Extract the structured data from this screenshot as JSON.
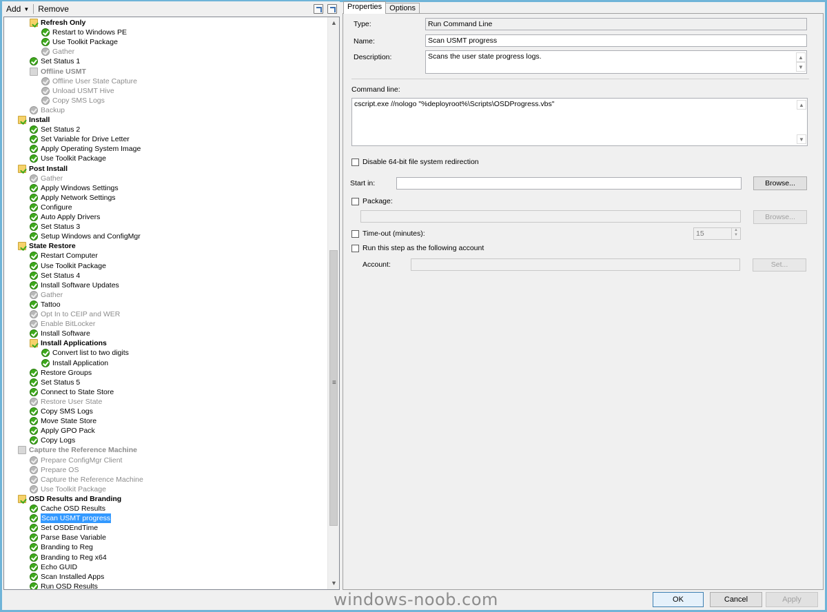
{
  "toolbar": {
    "add_label": "Add",
    "remove_label": "Remove",
    "icons": [
      "move-up-icon",
      "move-down-icon"
    ]
  },
  "tree": {
    "nodes": [
      {
        "label": "Refresh Only",
        "type": "group",
        "state": "enabled",
        "indent": 2
      },
      {
        "label": "Restart to Windows PE",
        "type": "step",
        "state": "enabled",
        "indent": 3
      },
      {
        "label": "Use Toolkit Package",
        "type": "step",
        "state": "enabled",
        "indent": 3
      },
      {
        "label": "Gather",
        "type": "step",
        "state": "disabled",
        "indent": 3
      },
      {
        "label": "Set Status 1",
        "type": "step",
        "state": "enabled",
        "indent": 2
      },
      {
        "label": "Offline USMT",
        "type": "group",
        "state": "disabled",
        "indent": 2
      },
      {
        "label": "Offline User State Capture",
        "type": "step",
        "state": "disabled",
        "indent": 3
      },
      {
        "label": "Unload USMT Hive",
        "type": "step",
        "state": "disabled",
        "indent": 3
      },
      {
        "label": "Copy SMS Logs",
        "type": "step",
        "state": "disabled",
        "indent": 3
      },
      {
        "label": "Backup",
        "type": "step",
        "state": "disabled",
        "indent": 2
      },
      {
        "label": "Install",
        "type": "group",
        "state": "enabled",
        "indent": 1
      },
      {
        "label": "Set Status 2",
        "type": "step",
        "state": "enabled",
        "indent": 2
      },
      {
        "label": "Set Variable for Drive Letter",
        "type": "step",
        "state": "enabled",
        "indent": 2
      },
      {
        "label": "Apply Operating System Image",
        "type": "step",
        "state": "enabled",
        "indent": 2
      },
      {
        "label": "Use Toolkit Package",
        "type": "step",
        "state": "enabled",
        "indent": 2
      },
      {
        "label": "Post Install",
        "type": "group",
        "state": "enabled",
        "indent": 1
      },
      {
        "label": "Gather",
        "type": "step",
        "state": "disabled",
        "indent": 2
      },
      {
        "label": "Apply Windows Settings",
        "type": "step",
        "state": "enabled",
        "indent": 2
      },
      {
        "label": "Apply Network Settings",
        "type": "step",
        "state": "enabled",
        "indent": 2
      },
      {
        "label": "Configure",
        "type": "step",
        "state": "enabled",
        "indent": 2
      },
      {
        "label": "Auto Apply Drivers",
        "type": "step",
        "state": "enabled",
        "indent": 2
      },
      {
        "label": "Set Status 3",
        "type": "step",
        "state": "enabled",
        "indent": 2
      },
      {
        "label": "Setup Windows and ConfigMgr",
        "type": "step",
        "state": "enabled",
        "indent": 2
      },
      {
        "label": "State Restore",
        "type": "group",
        "state": "enabled",
        "indent": 1
      },
      {
        "label": "Restart Computer",
        "type": "step",
        "state": "enabled",
        "indent": 2
      },
      {
        "label": "Use Toolkit Package",
        "type": "step",
        "state": "enabled",
        "indent": 2
      },
      {
        "label": "Set Status 4",
        "type": "step",
        "state": "enabled",
        "indent": 2
      },
      {
        "label": "Install Software Updates",
        "type": "step",
        "state": "enabled",
        "indent": 2
      },
      {
        "label": "Gather",
        "type": "step",
        "state": "disabled",
        "indent": 2
      },
      {
        "label": "Tattoo",
        "type": "step",
        "state": "enabled",
        "indent": 2
      },
      {
        "label": "Opt In to CEIP and WER",
        "type": "step",
        "state": "disabled",
        "indent": 2
      },
      {
        "label": "Enable BitLocker",
        "type": "step",
        "state": "disabled",
        "indent": 2
      },
      {
        "label": "Install Software",
        "type": "step",
        "state": "enabled",
        "indent": 2
      },
      {
        "label": "Install Applications",
        "type": "group",
        "state": "enabled",
        "indent": 2
      },
      {
        "label": "Convert list to two digits",
        "type": "step",
        "state": "enabled",
        "indent": 3
      },
      {
        "label": "Install Application",
        "type": "step",
        "state": "enabled",
        "indent": 3
      },
      {
        "label": "Restore Groups",
        "type": "step",
        "state": "enabled",
        "indent": 2
      },
      {
        "label": "Set Status 5",
        "type": "step",
        "state": "enabled",
        "indent": 2
      },
      {
        "label": "Connect to State Store",
        "type": "step",
        "state": "enabled",
        "indent": 2
      },
      {
        "label": "Restore User State",
        "type": "step",
        "state": "disabled",
        "indent": 2
      },
      {
        "label": "Copy SMS Logs",
        "type": "step",
        "state": "enabled",
        "indent": 2
      },
      {
        "label": "Move State Store",
        "type": "step",
        "state": "enabled",
        "indent": 2
      },
      {
        "label": "Apply GPO Pack",
        "type": "step",
        "state": "enabled",
        "indent": 2
      },
      {
        "label": "Copy Logs",
        "type": "step",
        "state": "enabled",
        "indent": 2
      },
      {
        "label": "Capture the Reference Machine",
        "type": "group",
        "state": "disabled",
        "indent": 1
      },
      {
        "label": "Prepare ConfigMgr Client",
        "type": "step",
        "state": "disabled",
        "indent": 2
      },
      {
        "label": "Prepare OS",
        "type": "step",
        "state": "disabled",
        "indent": 2
      },
      {
        "label": "Capture the Reference Machine",
        "type": "step",
        "state": "disabled",
        "indent": 2
      },
      {
        "label": "Use Toolkit Package",
        "type": "step",
        "state": "disabled",
        "indent": 2
      },
      {
        "label": "OSD Results and Branding",
        "type": "group",
        "state": "enabled",
        "indent": 1
      },
      {
        "label": "Cache OSD Results",
        "type": "step",
        "state": "enabled",
        "indent": 2
      },
      {
        "label": "Scan USMT progress",
        "type": "step",
        "state": "enabled",
        "indent": 2,
        "selected": true
      },
      {
        "label": "Set OSDEndTime",
        "type": "step",
        "state": "enabled",
        "indent": 2
      },
      {
        "label": "Parse Base Variable",
        "type": "step",
        "state": "enabled",
        "indent": 2
      },
      {
        "label": "Branding to Reg",
        "type": "step",
        "state": "enabled",
        "indent": 2
      },
      {
        "label": "Branding to Reg x64",
        "type": "step",
        "state": "enabled",
        "indent": 2
      },
      {
        "label": "Echo GUID",
        "type": "step",
        "state": "enabled",
        "indent": 2
      },
      {
        "label": "Scan Installed Apps",
        "type": "step",
        "state": "enabled",
        "indent": 2
      },
      {
        "label": "Run OSD Results",
        "type": "step",
        "state": "enabled",
        "indent": 2
      }
    ]
  },
  "tabs": {
    "properties": "Properties",
    "options": "Options"
  },
  "properties": {
    "type_label": "Type:",
    "type_value": "Run Command Line",
    "name_label": "Name:",
    "name_value": "Scan USMT progress",
    "description_label": "Description:",
    "description_value": "Scans the user state progress logs.",
    "command_line_label": "Command line:",
    "command_line_value": "cscript.exe //nologo \"%deployroot%\\Scripts\\OSDProgress.vbs\"",
    "disable64_label": "Disable 64-bit file system redirection",
    "start_in_label": "Start in:",
    "start_in_value": "",
    "browse_label": "Browse...",
    "package_label": "Package:",
    "package_value": "",
    "package_browse_label": "Browse...",
    "timeout_label": "Time-out (minutes):",
    "timeout_value": "15",
    "run_as_label": "Run this step as the following account",
    "account_label": "Account:",
    "account_value": "",
    "set_label": "Set..."
  },
  "footer": {
    "ok_label": "OK",
    "cancel_label": "Cancel",
    "apply_label": "Apply"
  },
  "watermark": "windows-noob.com"
}
